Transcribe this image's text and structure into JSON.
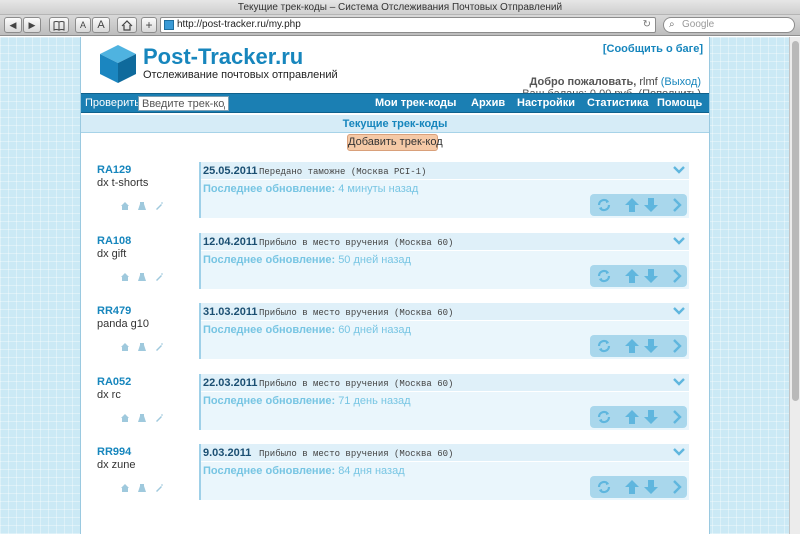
{
  "browser": {
    "title": "Текущие трек-коды – Система Отслеживания Почтовых Отправлений",
    "font_a_small": "A",
    "font_a_large": "A",
    "add_tab": "+",
    "url": "http://post-tracker.ru/my.php",
    "search_placeholder": "Google"
  },
  "site": {
    "brand": "Post-Tracker.ru",
    "tagline": "Отслеживание почтовых отправлений",
    "report_bug": "[Сообщить о баге]",
    "welcome_label": "Добро пожаловать,",
    "username": "rlmf",
    "logout": "(Выход)",
    "balance_text": "Ваш баланс: 0,00 руб. (Пополнить)",
    "brand_color": "#1786bd",
    "nav_color": "#1b7fb3"
  },
  "nav": {
    "check_label": "Проверить:",
    "check_placeholder": "Введите трек-код",
    "items": [
      "Мои трек-коды",
      "Архив",
      "Настройки",
      "Статистика",
      "Помощь"
    ]
  },
  "section_title": "Текущие трек-коды",
  "add_button": "Добавить трек-код",
  "update_label": "Последнее обновление:",
  "tracks": [
    {
      "code": "RA129",
      "desc": "dx t-shorts",
      "date": "25.05.2011",
      "status": "Передано таможне (Москва PCI-1)",
      "updated": "4 минуты назад"
    },
    {
      "code": "RA108",
      "desc": "dx gift",
      "date": "12.04.2011",
      "status": "Прибыло в место вручения (Москва 60)",
      "updated": "50 дней назад"
    },
    {
      "code": "RR479",
      "desc": "panda g10",
      "date": "31.03.2011",
      "status": "Прибыло в место вручения (Москва 60)",
      "updated": "60 дней назад"
    },
    {
      "code": "RA052",
      "desc": "dx rc",
      "date": "22.03.2011",
      "status": "Прибыло в место вручения (Москва 60)",
      "updated": "71 день назад"
    },
    {
      "code": "RR994",
      "desc": "dx zune",
      "date": "9.03.2011",
      "status": "Прибыло в место вручения (Москва 60)",
      "updated": "84 дня назад"
    }
  ]
}
